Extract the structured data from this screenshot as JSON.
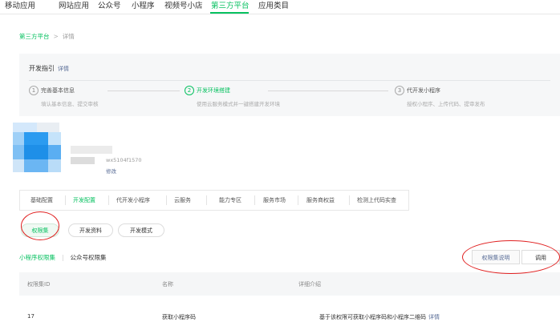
{
  "topnav": {
    "items": [
      "移动应用",
      "网站应用",
      "公众号",
      "小程序",
      "视频号小店",
      "第三方平台",
      "应用类目"
    ],
    "active": "第三方平台"
  },
  "breadcrumb": {
    "parent": "第三方平台",
    "separator": ">",
    "current": "详情"
  },
  "guide": {
    "title": "开发指引",
    "detail_link": "详情",
    "steps": [
      {
        "num": "1",
        "name": "完善基本信息",
        "desc": "填认基本信息、提交审核"
      },
      {
        "num": "2",
        "name": "开发环境搭建",
        "desc": "使用云服务模式并一键搭建开发环境"
      },
      {
        "num": "3",
        "name": "代开发小程序",
        "desc": "授权小程序、上传代码、提审发布"
      }
    ]
  },
  "app": {
    "appid_text": "wx5104f1570",
    "modify_label": "修改"
  },
  "tabs": [
    "基础配置",
    "开发配置",
    "代开发小程序",
    "云服务",
    "能力专区",
    "服务市场",
    "服务商权益",
    "检测上代码实查"
  ],
  "active_tab": "开发配置",
  "pills": {
    "permission": "权限集",
    "dev_material": "开发资料",
    "dev_mode": "开发模式"
  },
  "subtabs": {
    "mini": "小程序权限集",
    "separator": "|",
    "official": "公众号权限集"
  },
  "right_buttons": {
    "doc": "权限集说明",
    "debug": "调用"
  },
  "table": {
    "headers": [
      "权限集ID",
      "名称",
      "详细介绍"
    ],
    "rows": [
      {
        "id": "17",
        "name": "获取小程序码",
        "desc": "基于该权限可获取小程序码和小程序二维码",
        "more": "详情"
      }
    ]
  },
  "colors": {
    "accent": "#07c160",
    "link": "#576b95",
    "annotation": "#e02020"
  }
}
